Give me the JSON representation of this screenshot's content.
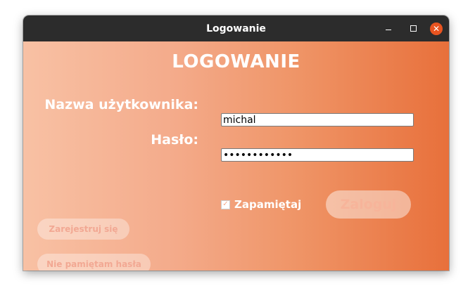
{
  "window": {
    "title": "Logowanie",
    "controls": [
      "minimize-icon",
      "maximize-icon",
      "close-icon"
    ]
  },
  "form": {
    "heading": "LOGOWANIE",
    "username_label": "Nazwa użytkownika:",
    "username_value": "michal",
    "password_label": "Hasło:",
    "password_value": "••••••••••••",
    "remember_label": "Zapamiętaj",
    "remember_checked": true,
    "login_label": "Zaloguj"
  },
  "links": {
    "register_label": "Zarejestruj się",
    "forgot_label": "Nie pamiętam hasła"
  },
  "colors": {
    "gradient_start": "#f8c1a4",
    "gradient_end": "#e8703b",
    "titlebar": "#2c2c2c",
    "close_button": "#e95420"
  }
}
